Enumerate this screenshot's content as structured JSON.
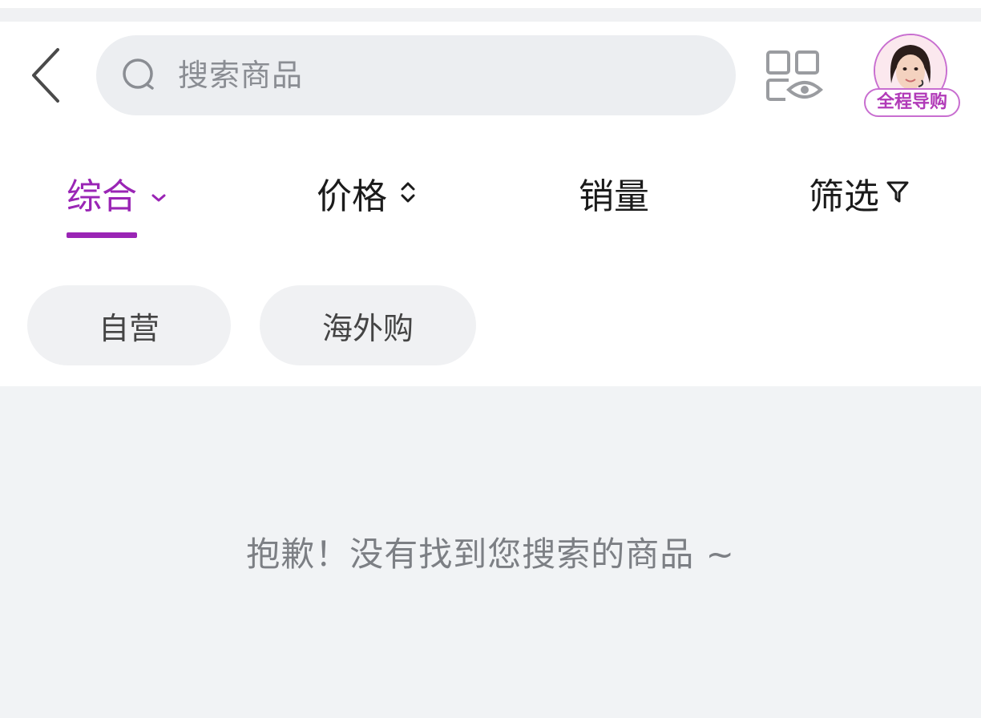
{
  "search": {
    "placeholder": "搜索商品"
  },
  "guide": {
    "label": "全程导购"
  },
  "sort_tabs": [
    {
      "label": "综合",
      "icon": "chevron-down-icon",
      "active": true
    },
    {
      "label": "价格",
      "icon": "sort-updown-icon",
      "active": false
    },
    {
      "label": "销量",
      "icon": "",
      "active": false
    },
    {
      "label": "筛选",
      "icon": "filter-icon",
      "active": false
    }
  ],
  "chips": [
    {
      "label": "自营"
    },
    {
      "label": "海外购"
    }
  ],
  "empty_state": {
    "message": "抱歉！没有找到您搜索的商品 ~"
  },
  "colors": {
    "accent": "#9a25b5",
    "background": "#f1f3f5",
    "search_bg": "#eceef1"
  }
}
